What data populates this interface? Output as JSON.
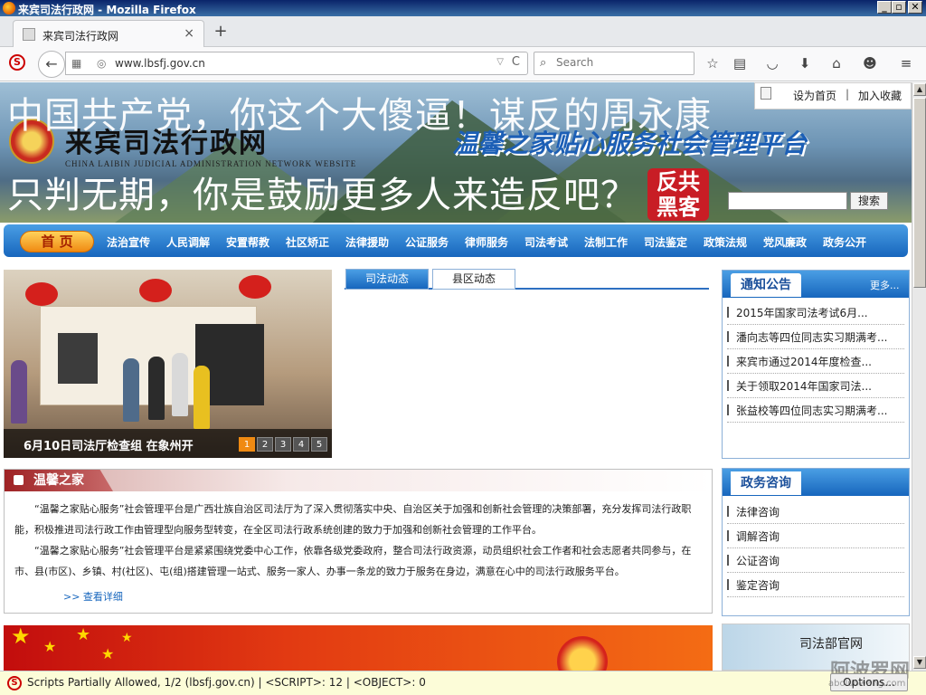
{
  "window": {
    "title": "来宾司法行政网 - Mozilla Firefox",
    "min": "_",
    "max": "▫",
    "close": "✕"
  },
  "tab": {
    "label": "来宾司法行政网",
    "close": "×",
    "new": "+"
  },
  "nav": {
    "url": "www.lbsfj.gov.cn",
    "search_placeholder": "Search",
    "back": "←",
    "dropdown": "▽",
    "reload": "C"
  },
  "toolbar_icons": [
    "star-icon",
    "reader-icon",
    "pocket-icon",
    "download-icon",
    "home-icon",
    "chat-icon",
    "menu-icon"
  ],
  "banner": {
    "site_name": "来宾司法行政网",
    "site_sub": "CHINA LAIBIN JUDICIAL ADMINISTRATION NETWORK WEBSITE",
    "slogan": "温馨之家贴心服务社会管理平台",
    "overlay1": "中国共产党，你这个大傻逼！谋反的周永康",
    "overlay2": "只判无期，你是鼓励更多人来造反吧？",
    "seal": "反共黑客",
    "set_home": "设为首页",
    "separator": "|",
    "favorite": "加入收藏",
    "search_btn": "搜索"
  },
  "mainnav": {
    "home": "首 页",
    "items": [
      "法治宣传",
      "人民调解",
      "安置帮教",
      "社区矫正",
      "法律援助",
      "公证服务",
      "律师服务",
      "司法考试",
      "法制工作",
      "司法鉴定",
      "政策法规",
      "党风廉政",
      "政务公开"
    ]
  },
  "slide": {
    "caption": "6月10日司法厅检查组 在象州开",
    "pages": [
      "1",
      "2",
      "3",
      "4",
      "5"
    ],
    "active_page": "1"
  },
  "news_tabs": [
    "司法动态",
    "县区动态"
  ],
  "notice": {
    "title": "通知公告",
    "more": "更多...",
    "items": [
      "2015年国家司法考试6月...",
      "潘向志等四位同志实习期满考...",
      "来宾市通过2014年度检查...",
      "关于领取2014年国家司法...",
      "张益校等四位同志实习期满考..."
    ]
  },
  "warm": {
    "title": "温馨之家",
    "p1": "“温馨之家贴心服务”社会管理平台是广西壮族自治区司法厅为了深入贯彻落实中央、自治区关于加强和创新社会管理的决策部署，充分发挥司法行政职能，积极推进司法行政工作由管理型向服务型转变，在全区司法行政系统创建的致力于加强和创新社会管理的工作平台。",
    "p2": "“温馨之家贴心服务”社会管理平台是紧紧围绕党委中心工作，依靠各级党委政府，整合司法行政资源，动员组织社会工作者和社会志愿者共同参与，在市、县(市区)、乡镇、村(社区)、屯(组)搭建管理一站式、服务一家人、办事一条龙的致力于服务在身边，满意在心中的司法行政服务平台。",
    "more": ">>  查看详细"
  },
  "consult": {
    "title": "政务咨询",
    "items": [
      "法律咨询",
      "调解咨询",
      "公证咨询",
      "鉴定咨询"
    ]
  },
  "side_banner": {
    "label": "司法部官网"
  },
  "status": {
    "text": "Scripts Partially Allowed, 1/2 (lbsfj.gov.cn) | <SCRIPT>: 12 | <OBJECT>: 0",
    "options": "Options..."
  },
  "watermark": {
    "main": "阿波罗网",
    "sub": "aboluowang.com"
  }
}
